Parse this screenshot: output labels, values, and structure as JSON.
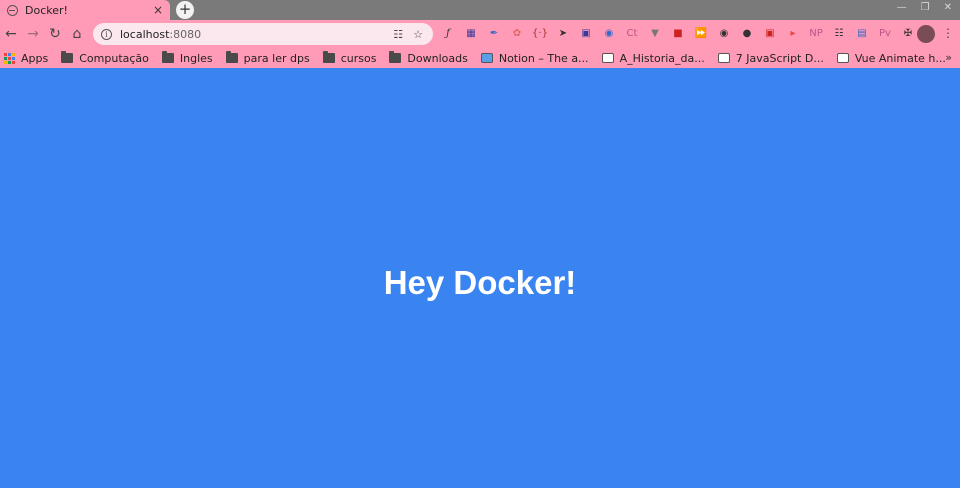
{
  "browser": {
    "tab": {
      "title": "Docker!",
      "close": "×"
    },
    "new_tab": "+",
    "address": {
      "host": "localhost",
      "port": ":8080"
    },
    "bookmarks": [
      {
        "label": "Apps",
        "kind": "apps"
      },
      {
        "label": "Computação",
        "kind": "folder"
      },
      {
        "label": "Ingles",
        "kind": "folder"
      },
      {
        "label": "para ler dps",
        "kind": "folder"
      },
      {
        "label": "cursos",
        "kind": "folder"
      },
      {
        "label": "Downloads",
        "kind": "folder"
      },
      {
        "label": "Notion – The a...",
        "kind": "site"
      },
      {
        "label": "A_Historia_da...",
        "kind": "site"
      },
      {
        "label": "7 JavaScript D...",
        "kind": "site"
      },
      {
        "label": "Vue Animate h...",
        "kind": "site"
      }
    ],
    "more_bookmarks": "»"
  },
  "page": {
    "heading": "Hey Docker!",
    "background_color": "#3a84f1"
  }
}
